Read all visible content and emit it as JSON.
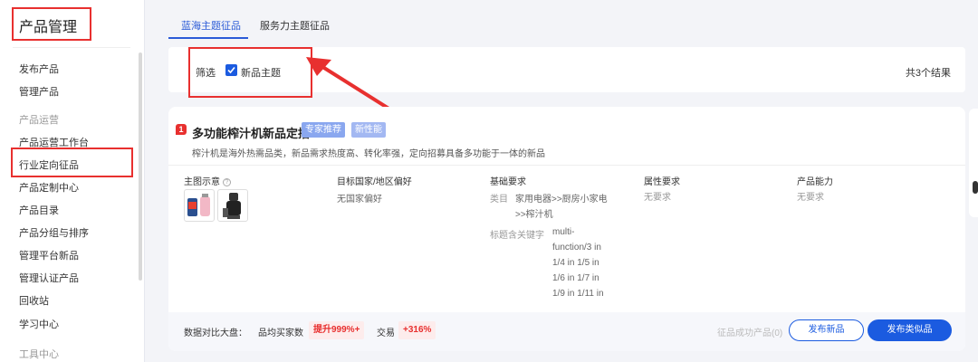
{
  "sidebar": {
    "title": "产品管理",
    "items": [
      "发布产品",
      "管理产品"
    ],
    "group1": "产品运营",
    "group1_items": [
      "产品运营工作台",
      "行业定向征品",
      "产品定制中心",
      "产品目录",
      "产品分组与排序",
      "管理平台新品",
      "管理认证产品",
      "回收站",
      "学习中心"
    ],
    "group2": "工具中心"
  },
  "tabs": [
    "蓝海主题征品",
    "服务力主题征品"
  ],
  "filter": {
    "label": "筛选",
    "checkbox_label": "新品主题",
    "checked": true,
    "result_count": "共3个结果"
  },
  "card": {
    "rank": "1",
    "title": "多功能榨汁机新品定招",
    "tags": [
      "专家推荐",
      "新性能"
    ],
    "description": "榨汁机是海外热需品类，新品需求热度高、转化率强，定向招募具备多功能于一体的新品",
    "columns": {
      "main_image": {
        "head": "主图示意",
        "help": "?"
      },
      "target_country": {
        "head": "目标国家/地区偏好",
        "value": "无国家偏好"
      },
      "basic": {
        "head": "基础要求",
        "category_label": "类目",
        "category_value": [
          "家用电器>>厨房小家电",
          ">>榨汁机"
        ],
        "keyword_label": "标题含关键字",
        "keyword_value": [
          "multi-",
          "function/3 in",
          "1/4 in 1/5 in",
          "1/6 in 1/7 in",
          "1/9 in 1/11 in"
        ]
      },
      "attribute": {
        "head": "属性要求",
        "value": "无要求"
      },
      "capability": {
        "head": "产品能力",
        "value": "无要求"
      }
    },
    "footer": {
      "label": "数据对比大盘：",
      "stat1_label": "品均买家数",
      "stat1_value": "提升999%+",
      "stat2_label": "交易",
      "stat2_value": "+316%",
      "success_text": "征品成功产品(0)",
      "btn_publish": "发布新品",
      "btn_similar": "发布类似品"
    }
  },
  "colors": {
    "accent": "#1b5be0",
    "highlight": "#e8302f"
  }
}
